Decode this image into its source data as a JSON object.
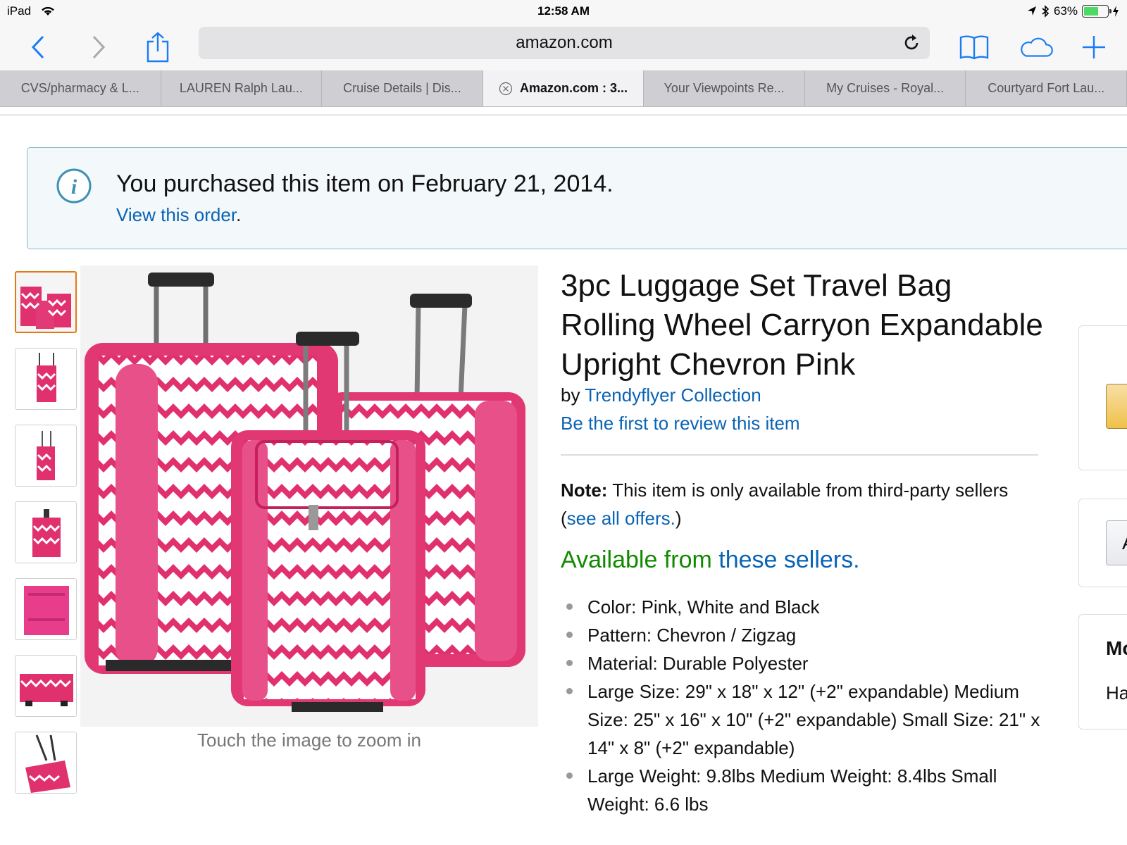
{
  "status_bar": {
    "device": "iPad",
    "time": "12:58 AM",
    "battery_percent": "63%",
    "battery_level": 0.63
  },
  "toolbar": {
    "url": "amazon.com"
  },
  "tabs": [
    {
      "label": "CVS/pharmacy & L..."
    },
    {
      "label": "LAUREN Ralph Lau..."
    },
    {
      "label": "Cruise Details | Dis..."
    },
    {
      "label": "Amazon.com : 3..."
    },
    {
      "label": "Your Viewpoints Re..."
    },
    {
      "label": "My Cruises - Royal..."
    },
    {
      "label": "Courtyard Fort Lau..."
    }
  ],
  "alert": {
    "message": "You purchased this item on February 21, 2014.",
    "link": "View this order",
    "link_suffix": "."
  },
  "gallery": {
    "zoom_hint": "Touch the image to zoom in"
  },
  "product": {
    "title": "3pc Luggage Set Travel Bag Rolling Wheel Carryon Expandable Upright Chevron Pink",
    "by_prefix": "by ",
    "brand": "Trendyflyer Collection",
    "review_link": "Be the first to review this item",
    "note_label": "Note:",
    "note_text": " This item is only available from third-party sellers",
    "note_open": "(",
    "note_link": "see all offers.",
    "note_close": ")",
    "available_text": "Available from ",
    "available_link": "these sellers.",
    "bullets": [
      "Color: Pink, White and Black",
      "Pattern: Chevron / Zigzag",
      "Material: Durable Polyester",
      "Large Size: 29\" x 18\" x 12\" (+2\" expandable) Medium Size: 25\" x 16\" x 10\" (+2\" expandable) Small Size: 21\" x 14\" x 8\" (+2\" expandable)",
      "Large Weight: 9.8lbs Medium Weight: 8.4lbs Small Weight: 6.6 lbs"
    ]
  },
  "side": {
    "button_partial": "A",
    "more_partial": "Mo",
    "sub_partial": "Ha"
  },
  "colors": {
    "link": "#0a63b4",
    "available_green": "#118a00",
    "accent_orange": "#e47911",
    "ios_blue": "#1a7cf5",
    "luggage_pink": "#e0306e"
  }
}
